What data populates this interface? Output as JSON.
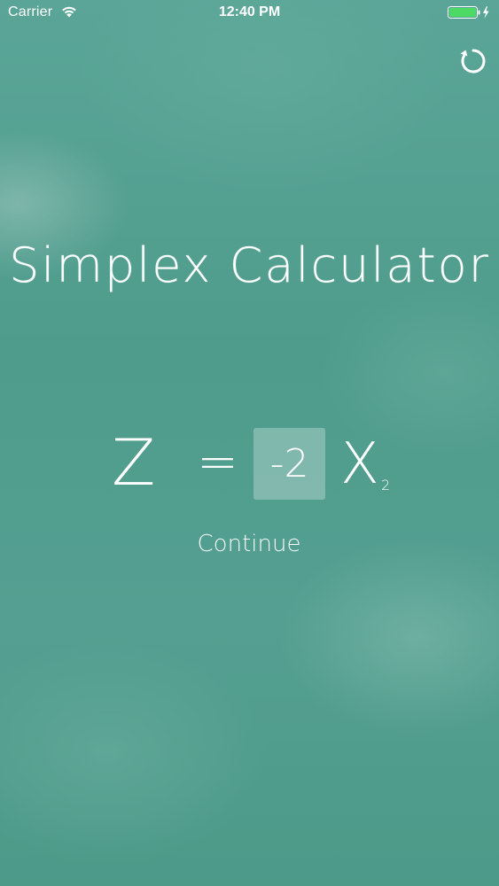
{
  "status_bar": {
    "carrier": "Carrier",
    "time": "12:40 PM",
    "battery_color": "#4cd964"
  },
  "header": {
    "reset_icon": "refresh-icon"
  },
  "main": {
    "title": "Simplex Calculator",
    "equation": {
      "lhs": "Z",
      "operator": "=",
      "coefficient_value": "-2",
      "variable": "X",
      "subscript": "2"
    },
    "continue_label": "Continue"
  }
}
